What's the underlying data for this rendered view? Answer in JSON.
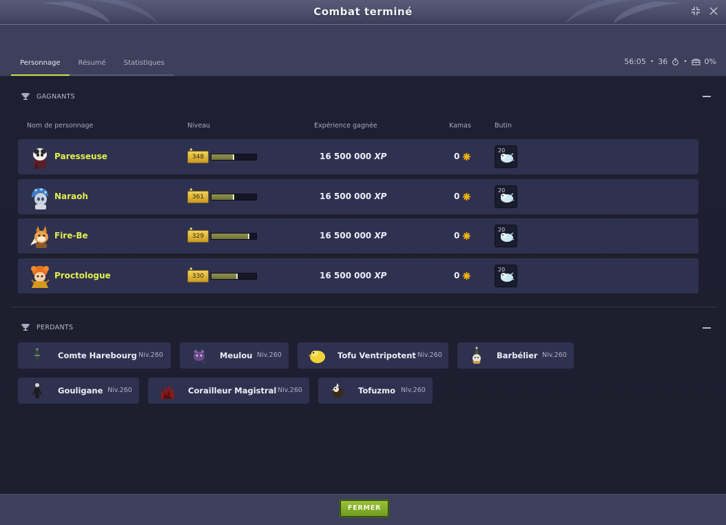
{
  "window": {
    "title": "Combat terminé"
  },
  "tabs": [
    {
      "label": "Personnage",
      "active": true
    },
    {
      "label": "Résumé",
      "active": false
    },
    {
      "label": "Statistiques",
      "active": false
    }
  ],
  "stats": {
    "duration": "56:05",
    "turns": "36",
    "bonus": "0%"
  },
  "winners": {
    "title": "GAGNANTS",
    "columns": {
      "name": "Nom de personnage",
      "level": "Niveau",
      "xp": "Expérience gagnée",
      "kamas": "Kamas",
      "loot": "Butin"
    },
    "rows": [
      {
        "name": "Paresseuse",
        "level": "348",
        "level_progress": 0.5,
        "xp": "16 500 000",
        "xp_unit": "XP",
        "kamas": "0",
        "loot_qty": "20"
      },
      {
        "name": "Naraoh",
        "level": "361",
        "level_progress": 0.5,
        "xp": "16 500 000",
        "xp_unit": "XP",
        "kamas": "0",
        "loot_qty": "20"
      },
      {
        "name": "Fire-Be",
        "level": "329",
        "level_progress": 0.85,
        "xp": "16 500 000",
        "xp_unit": "XP",
        "kamas": "0",
        "loot_qty": "20"
      },
      {
        "name": "Proctologue",
        "level": "330",
        "level_progress": 0.58,
        "xp": "16 500 000",
        "xp_unit": "XP",
        "kamas": "0",
        "loot_qty": "20"
      }
    ]
  },
  "losers": {
    "title": "PERDANTS",
    "items": [
      {
        "name": "Comte Harebourg",
        "level": "Niv.260"
      },
      {
        "name": "Meulou",
        "level": "Niv.260"
      },
      {
        "name": "Tofu Ventripotent",
        "level": "Niv.260"
      },
      {
        "name": "Barbélier",
        "level": "Niv.260"
      },
      {
        "name": "Gouligane",
        "level": "Niv.260"
      },
      {
        "name": "Corailleur Magistral",
        "level": "Niv.260"
      },
      {
        "name": "Tofuzmo",
        "level": "Niv.260"
      }
    ]
  },
  "footer": {
    "close_label": "FERMER"
  },
  "colors": {
    "accent": "#c8e04a",
    "winner_name": "#e2ef4e",
    "button": "#8cb02f"
  }
}
